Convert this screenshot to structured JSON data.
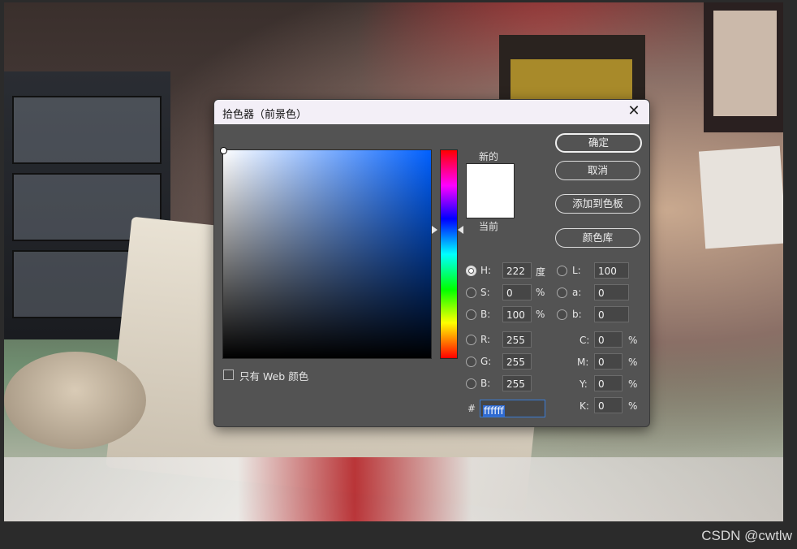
{
  "dialog": {
    "title": "拾色器（前景色）",
    "close_symbol": "✕",
    "label_new": "新的",
    "label_current": "当前",
    "current_color": "#ffffff",
    "hue_gradient_top_color": "#0060ff",
    "buttons": {
      "ok": "确定",
      "cancel": "取消",
      "add_to_swatches": "添加到色板",
      "color_libraries": "颜色库"
    },
    "hsb": {
      "h_label": "H:",
      "h_value": "222",
      "h_unit": "度",
      "s_label": "S:",
      "s_value": "0",
      "s_unit": "%",
      "b_label": "B:",
      "b_value": "100",
      "b_unit": "%"
    },
    "rgb": {
      "r_label": "R:",
      "r_value": "255",
      "g_label": "G:",
      "g_value": "255",
      "b_label": "B:",
      "b_value": "255"
    },
    "lab": {
      "l_label": "L:",
      "l_value": "100",
      "a_label": "a:",
      "a_value": "0",
      "b_label": "b:",
      "b_value": "0"
    },
    "cmyk": {
      "c_label": "C:",
      "c_value": "0",
      "c_unit": "%",
      "m_label": "M:",
      "m_value": "0",
      "m_unit": "%",
      "y_label": "Y:",
      "y_value": "0",
      "y_unit": "%",
      "k_label": "K:",
      "k_value": "0",
      "k_unit": "%"
    },
    "web_only_label": "只有 Web 颜色",
    "hex_label": "#",
    "hex_value": "ffffff"
  },
  "watermark": "CSDN @cwtlw"
}
